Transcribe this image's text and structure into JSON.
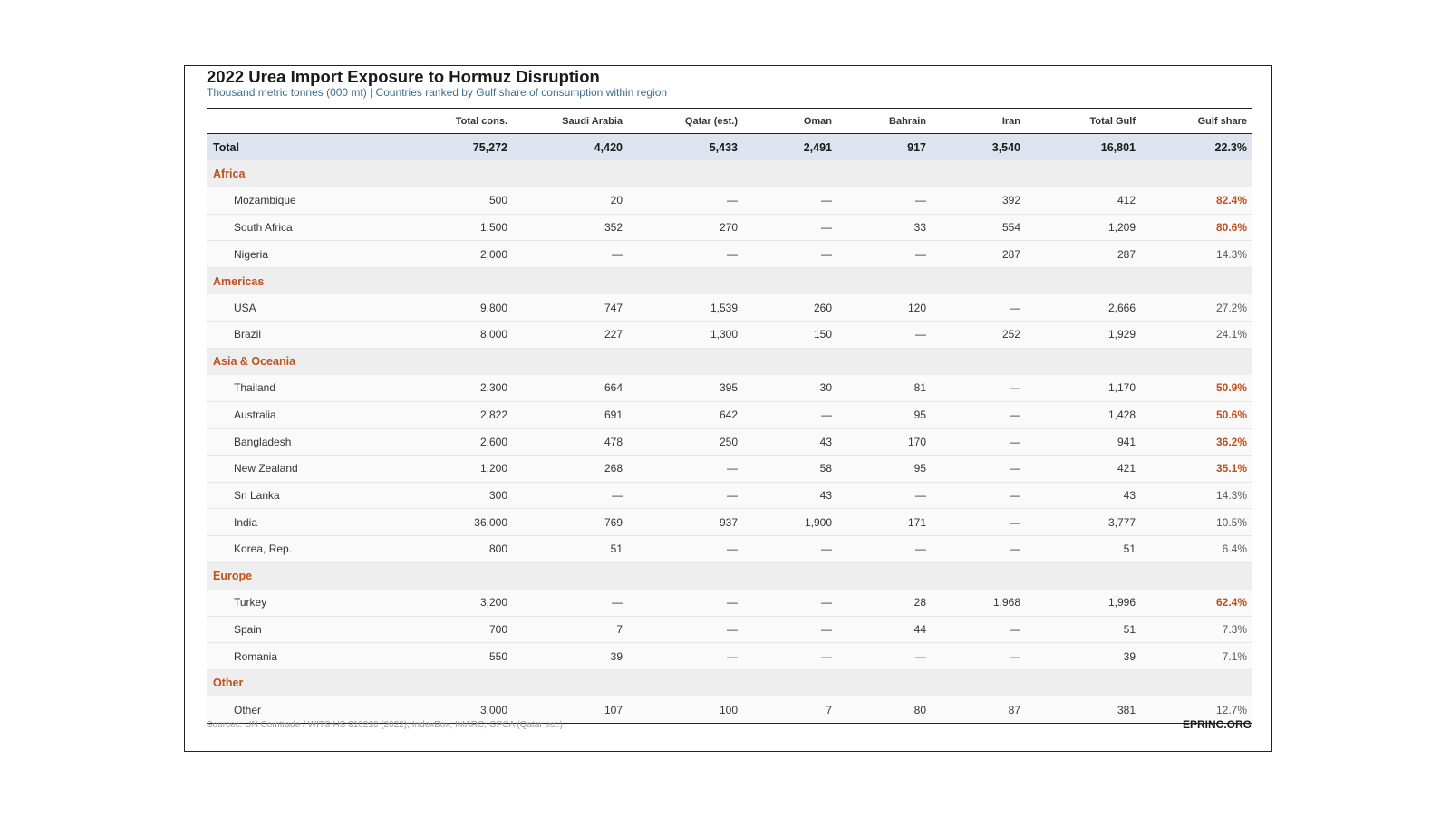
{
  "chart_data": {
    "type": "table",
    "title": "2022 Urea Import Exposure to Hormuz Disruption",
    "subtitle": "Thousand metric tonnes (000 mt) | Countries ranked by Gulf share of consumption within region",
    "columns": [
      "",
      "Total cons.",
      "Saudi Arabia",
      "Qatar (est.)",
      "Oman",
      "Bahrain",
      "Iran",
      "Total Gulf",
      "Gulf share"
    ],
    "total": {
      "label": "Total",
      "values": [
        "75,272",
        "4,420",
        "5,433",
        "2,491",
        "917",
        "3,540",
        "16,801",
        "22.3%"
      ]
    },
    "regions": [
      {
        "name": "Africa",
        "rows": [
          {
            "label": "Mozambique",
            "values": [
              "500",
              "20",
              "—",
              "—",
              "—",
              "392",
              "412",
              "82.4%"
            ],
            "highlight": true
          },
          {
            "label": "South Africa",
            "values": [
              "1,500",
              "352",
              "270",
              "—",
              "33",
              "554",
              "1,209",
              "80.6%"
            ],
            "highlight": true
          },
          {
            "label": "Nigeria",
            "values": [
              "2,000",
              "—",
              "—",
              "—",
              "—",
              "287",
              "287",
              "14.3%"
            ],
            "highlight": false
          }
        ]
      },
      {
        "name": "Americas",
        "rows": [
          {
            "label": "USA",
            "values": [
              "9,800",
              "747",
              "1,539",
              "260",
              "120",
              "—",
              "2,666",
              "27.2%"
            ],
            "highlight": false
          },
          {
            "label": "Brazil",
            "values": [
              "8,000",
              "227",
              "1,300",
              "150",
              "—",
              "252",
              "1,929",
              "24.1%"
            ],
            "highlight": false
          }
        ]
      },
      {
        "name": "Asia & Oceania",
        "rows": [
          {
            "label": "Thailand",
            "values": [
              "2,300",
              "664",
              "395",
              "30",
              "81",
              "—",
              "1,170",
              "50.9%"
            ],
            "highlight": true
          },
          {
            "label": "Australia",
            "values": [
              "2,822",
              "691",
              "642",
              "—",
              "95",
              "—",
              "1,428",
              "50.6%"
            ],
            "highlight": true
          },
          {
            "label": "Bangladesh",
            "values": [
              "2,600",
              "478",
              "250",
              "43",
              "170",
              "—",
              "941",
              "36.2%"
            ],
            "highlight": true
          },
          {
            "label": "New Zealand",
            "values": [
              "1,200",
              "268",
              "—",
              "58",
              "95",
              "—",
              "421",
              "35.1%"
            ],
            "highlight": true
          },
          {
            "label": "Sri Lanka",
            "values": [
              "300",
              "—",
              "—",
              "43",
              "—",
              "—",
              "43",
              "14.3%"
            ],
            "highlight": false
          },
          {
            "label": "India",
            "values": [
              "36,000",
              "769",
              "937",
              "1,900",
              "171",
              "—",
              "3,777",
              "10.5%"
            ],
            "highlight": false
          },
          {
            "label": "Korea, Rep.",
            "values": [
              "800",
              "51",
              "—",
              "—",
              "—",
              "—",
              "51",
              "6.4%"
            ],
            "highlight": false
          }
        ]
      },
      {
        "name": "Europe",
        "rows": [
          {
            "label": "Turkey",
            "values": [
              "3,200",
              "—",
              "—",
              "—",
              "28",
              "1,968",
              "1,996",
              "62.4%"
            ],
            "highlight": true
          },
          {
            "label": "Spain",
            "values": [
              "700",
              "7",
              "—",
              "—",
              "44",
              "—",
              "51",
              "7.3%"
            ],
            "highlight": false
          },
          {
            "label": "Romania",
            "values": [
              "550",
              "39",
              "—",
              "—",
              "—",
              "—",
              "39",
              "7.1%"
            ],
            "highlight": false
          }
        ]
      },
      {
        "name": "Other",
        "rows": [
          {
            "label": "Other",
            "values": [
              "3,000",
              "107",
              "100",
              "7",
              "80",
              "87",
              "381",
              "12.7%"
            ],
            "highlight": false
          }
        ]
      }
    ],
    "colors": {
      "accent": "#c0501c",
      "subtitle": "#3c6e8f",
      "total_bg": "#dde4ef",
      "region_bg": "#eeeeee"
    }
  },
  "footer": {
    "sources": "Sources: UN Comtrade / WITS HS 310210 (2022); IndexBox; IMARC; GPCA (Qatar est.)",
    "brand": "EPRINC.ORG"
  }
}
